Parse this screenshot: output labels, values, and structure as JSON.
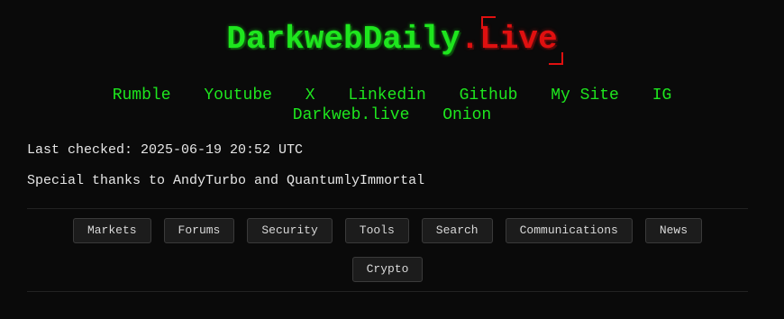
{
  "header": {
    "logo_main": "DarkwebDaily",
    "logo_accent": ".Live"
  },
  "social_links": [
    {
      "label": "Rumble"
    },
    {
      "label": "Youtube"
    },
    {
      "label": "X"
    },
    {
      "label": "Linkedin"
    },
    {
      "label": "Github"
    },
    {
      "label": "My Site"
    },
    {
      "label": "IG"
    },
    {
      "label": "Darkweb.live"
    },
    {
      "label": "Onion"
    }
  ],
  "meta": {
    "last_checked": "Last checked: 2025-06-19 20:52 UTC",
    "thanks": "Special thanks to AndyTurbo and QuantumlyImmortal"
  },
  "categories": [
    {
      "label": "Markets"
    },
    {
      "label": "Forums"
    },
    {
      "label": "Security"
    },
    {
      "label": "Tools"
    },
    {
      "label": "Search"
    },
    {
      "label": "Communications"
    },
    {
      "label": "News"
    },
    {
      "label": "Crypto"
    }
  ],
  "colors": {
    "background": "#0a0a0a",
    "brand_green": "#1ee61e",
    "brand_red": "#e01010",
    "text": "#e6e6e6",
    "button_bg": "#1c1c1c",
    "button_border": "#3a3a3a"
  }
}
